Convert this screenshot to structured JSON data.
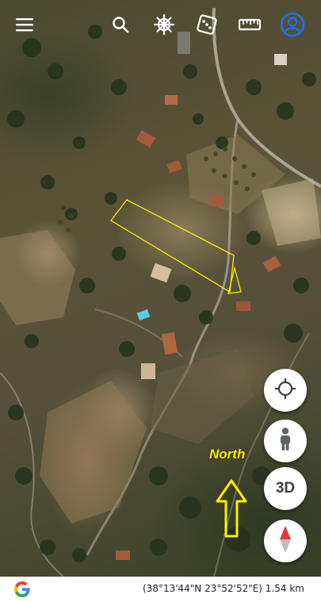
{
  "map": {
    "type": "satellite",
    "compass_label": "North"
  },
  "toolbar": {
    "menu_icon": "menu-icon",
    "search_icon": "search-icon",
    "voyager_icon": "ship-wheel-icon",
    "feeling_lucky_icon": "dice-icon",
    "measure_icon": "ruler-icon",
    "account_icon": "account-icon",
    "accent_color": "#1a73e8"
  },
  "controls": {
    "my_location_icon": "crosshair-icon",
    "pegman_icon": "pegman-icon",
    "view_3d_label": "3D",
    "compass_icon": "compass-icon"
  },
  "footer": {
    "logo_icon": "google-g-icon",
    "status_line": "(38°13'44\"N 23°52'52\"E) 1.54 km"
  },
  "annotations": {
    "outline_color": "#ffee00"
  }
}
